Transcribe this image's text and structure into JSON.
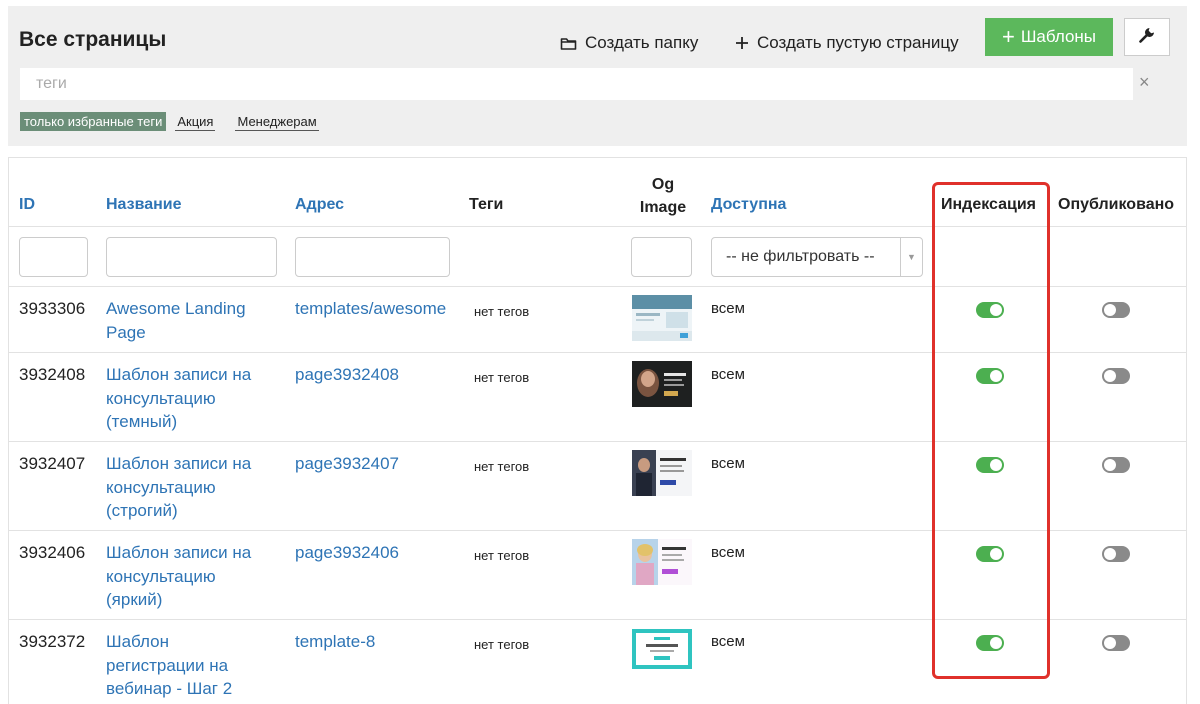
{
  "header": {
    "title": "Все страницы",
    "create_folder_label": "Создать папку",
    "create_page_label": "Создать пустую страницу",
    "templates_label": "Шаблоны",
    "tags_placeholder": "теги",
    "clear_symbol": "×",
    "tag_filters": {
      "favorites_only": "только избранные теги",
      "tags": [
        "Акция",
        "Менеджерам"
      ]
    }
  },
  "table": {
    "columns": {
      "id": "ID",
      "name": "Название",
      "address": "Адрес",
      "tags": "Теги",
      "og_image_line1": "Og",
      "og_image_line2": "Image",
      "access": "Доступна",
      "indexing": "Индексация",
      "published": "Опубликовано"
    },
    "access_filter_value": "-- не фильтровать --",
    "rows": [
      {
        "id": "3933306",
        "name": "Awesome Landing Page",
        "address": "templates/awesome",
        "tags": "нет тегов",
        "access": "всем",
        "indexing": true,
        "published": false,
        "thumb": "landing"
      },
      {
        "id": "3932408",
        "name": "Шаблон записи на консультацию (темный)",
        "address": "page3932408",
        "tags": "нет тегов",
        "access": "всем",
        "indexing": true,
        "published": false,
        "thumb": "dark"
      },
      {
        "id": "3932407",
        "name": "Шаблон записи на консультацию (строгий)",
        "address": "page3932407",
        "tags": "нет тегов",
        "access": "всем",
        "indexing": true,
        "published": false,
        "thumb": "strict"
      },
      {
        "id": "3932406",
        "name": "Шаблон записи на консультацию (яркий)",
        "address": "page3932406",
        "tags": "нет тегов",
        "access": "всем",
        "indexing": true,
        "published": false,
        "thumb": "bright"
      },
      {
        "id": "3932372",
        "name": "Шаблон регистрации на вебинар - Шаг 2",
        "address": "template-8",
        "tags": "нет тегов",
        "access": "всем",
        "indexing": true,
        "published": false,
        "thumb": "teal"
      }
    ]
  },
  "colors": {
    "accent_green": "#5cb85c",
    "link_blue": "#2e74b5",
    "highlight_red": "#e0312b",
    "toggle_on": "#4caf50",
    "toggle_off": "#8a8a8a"
  },
  "icons": {
    "folder": "folder-icon",
    "plus": "plus-icon",
    "settings": "wrench-icon",
    "clear": "close-icon",
    "dropdown": "chevron-down-icon"
  }
}
